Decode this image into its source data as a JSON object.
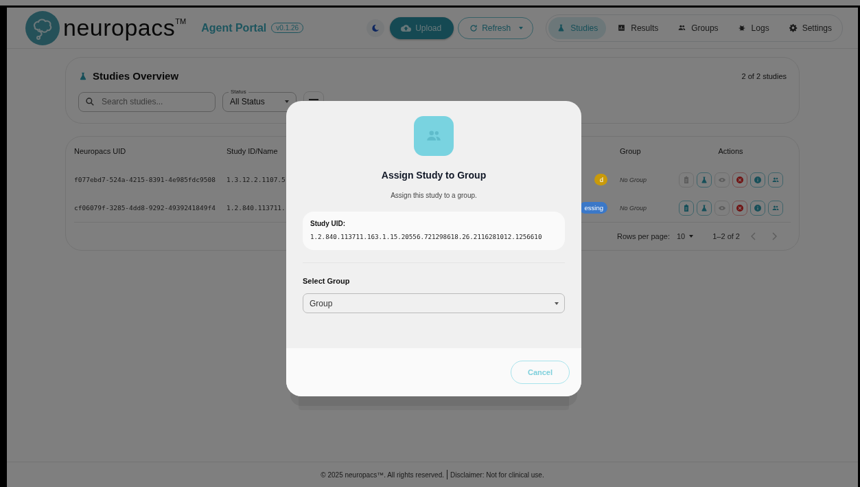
{
  "header": {
    "brand": "neuropacs",
    "brand_mark": "TM",
    "app_name": "Agent Portal",
    "version": "v0.1.26",
    "upload_button": "Upload",
    "refresh_button": "Refresh",
    "nav": [
      {
        "label": "Studies",
        "selected": true
      },
      {
        "label": "Results",
        "selected": false
      },
      {
        "label": "Groups",
        "selected": false
      },
      {
        "label": "Logs",
        "selected": false
      },
      {
        "label": "Settings",
        "selected": false
      }
    ]
  },
  "overview": {
    "title": "Studies Overview",
    "count": "2 of 2 studies",
    "search": {
      "placeholder": "Search studies..."
    },
    "status_filter": {
      "label": "Status",
      "value": "All Status"
    }
  },
  "table": {
    "columns": [
      "Neuropacs UID",
      "Study ID/Name",
      "Group",
      "Actions"
    ],
    "rows": [
      {
        "uid": "f077ebd7-524a-4215-8391-4e985fdc9508",
        "study_id": "1.3.12.2.1107.5",
        "status": "d",
        "color": "#c99a0a",
        "group": "No Group",
        "actions": [
          {
            "kind": "report",
            "disabled": true
          },
          {
            "kind": "flask",
            "disabled": false
          },
          {
            "kind": "view",
            "disabled": true
          },
          {
            "kind": "cancel",
            "disabled": false
          },
          {
            "kind": "info",
            "disabled": false
          },
          {
            "kind": "group",
            "disabled": false
          }
        ]
      },
      {
        "uid": "cf06079f-3285-4dd8-9292-4939241849f4",
        "study_id": "1.2.840.113711.",
        "status": "essing",
        "color": "#3b78c8",
        "group": "No Group",
        "actions": [
          {
            "kind": "report",
            "disabled": false
          },
          {
            "kind": "flask",
            "disabled": false
          },
          {
            "kind": "view",
            "disabled": true
          },
          {
            "kind": "cancel",
            "disabled": false
          },
          {
            "kind": "info",
            "disabled": false
          },
          {
            "kind": "group",
            "disabled": false
          }
        ]
      }
    ],
    "pagination": {
      "rows_per_page_label": "Rows per page:",
      "rows_per_page": "10",
      "range": "1–2 of 2"
    }
  },
  "dialog": {
    "title": "Assign Study to Group",
    "subtitle": "Assign this study to a group.",
    "uid_label": "Study UID:",
    "uid_value": "1.2.840.113711.163.1.15.20556.721298618.26.2116281012.1256610",
    "select_label": "Select Group",
    "select": {
      "placeholder": "Group"
    },
    "cancel_button": "Cancel"
  },
  "footer": {
    "copyright": "© 2025 neuropacs™. All rights reserved.",
    "disclaimer": "Disclaimer: Not for clinical use."
  }
}
